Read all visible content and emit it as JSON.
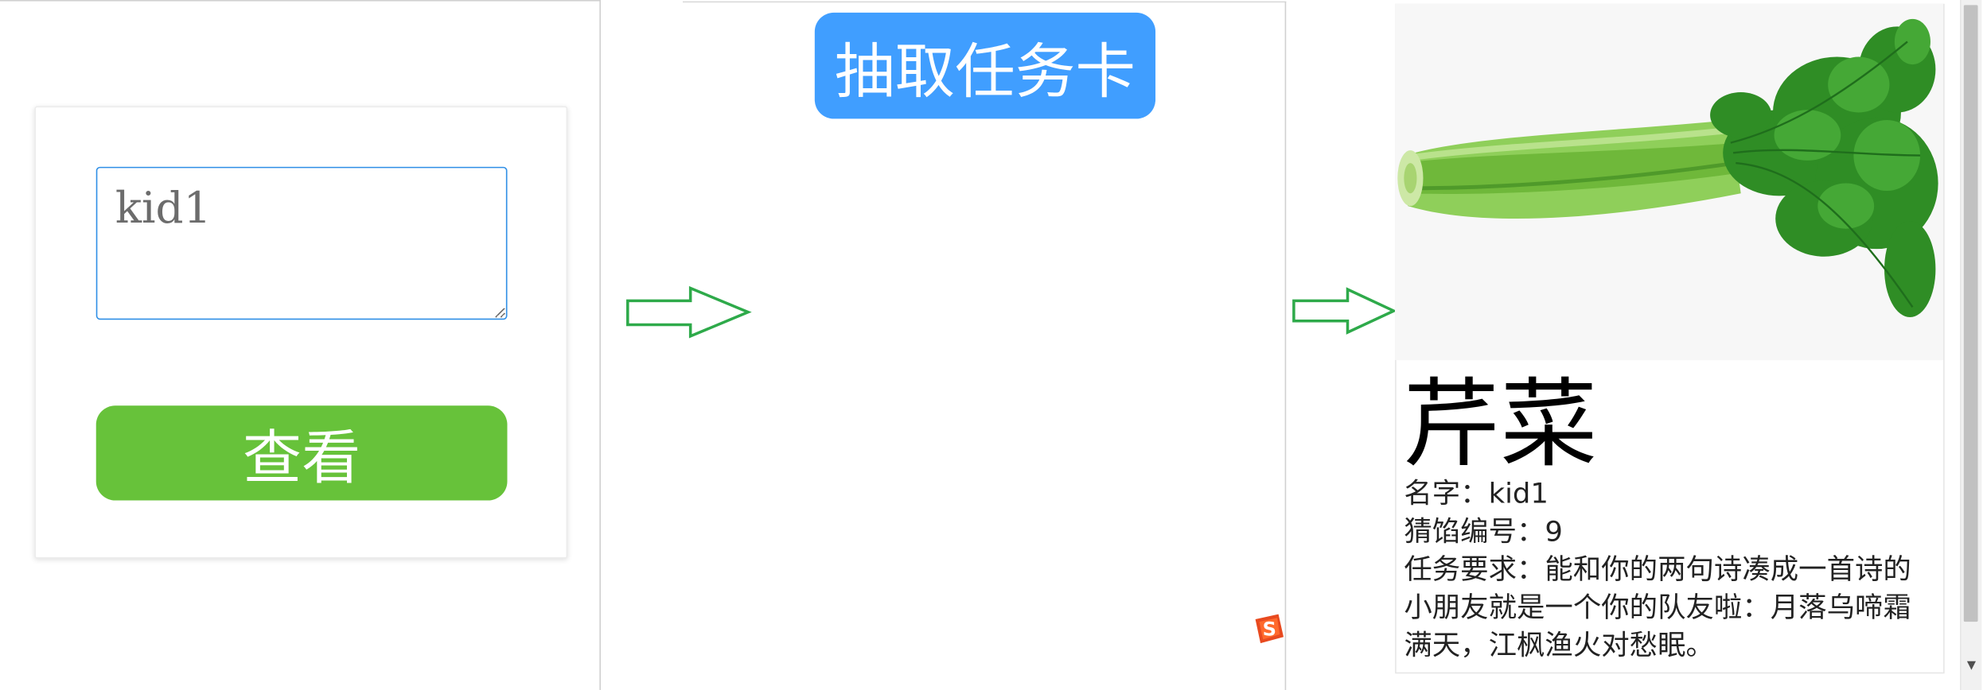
{
  "login": {
    "name_value": "kid1",
    "view_button_label": "查看"
  },
  "draw": {
    "button_label": "抽取任务卡"
  },
  "card": {
    "title": "芹菜",
    "name_line": "名字：kid1",
    "riddle_number_line": "猜馅编号：9",
    "task_line": "任务要求：能和你的两句诗凑成一首诗的小朋友就是一个你的队友啦：月落乌啼霜满天，江枫渔火对愁眠。"
  },
  "icons": {
    "arrow": "right-arrow-icon",
    "ime": "sogou-ime-icon",
    "image": "celery-image"
  },
  "colors": {
    "view_button": "#67c23a",
    "draw_button": "#409eff",
    "arrow": "#2eaa4a",
    "input_border": "#2f8fe6"
  }
}
